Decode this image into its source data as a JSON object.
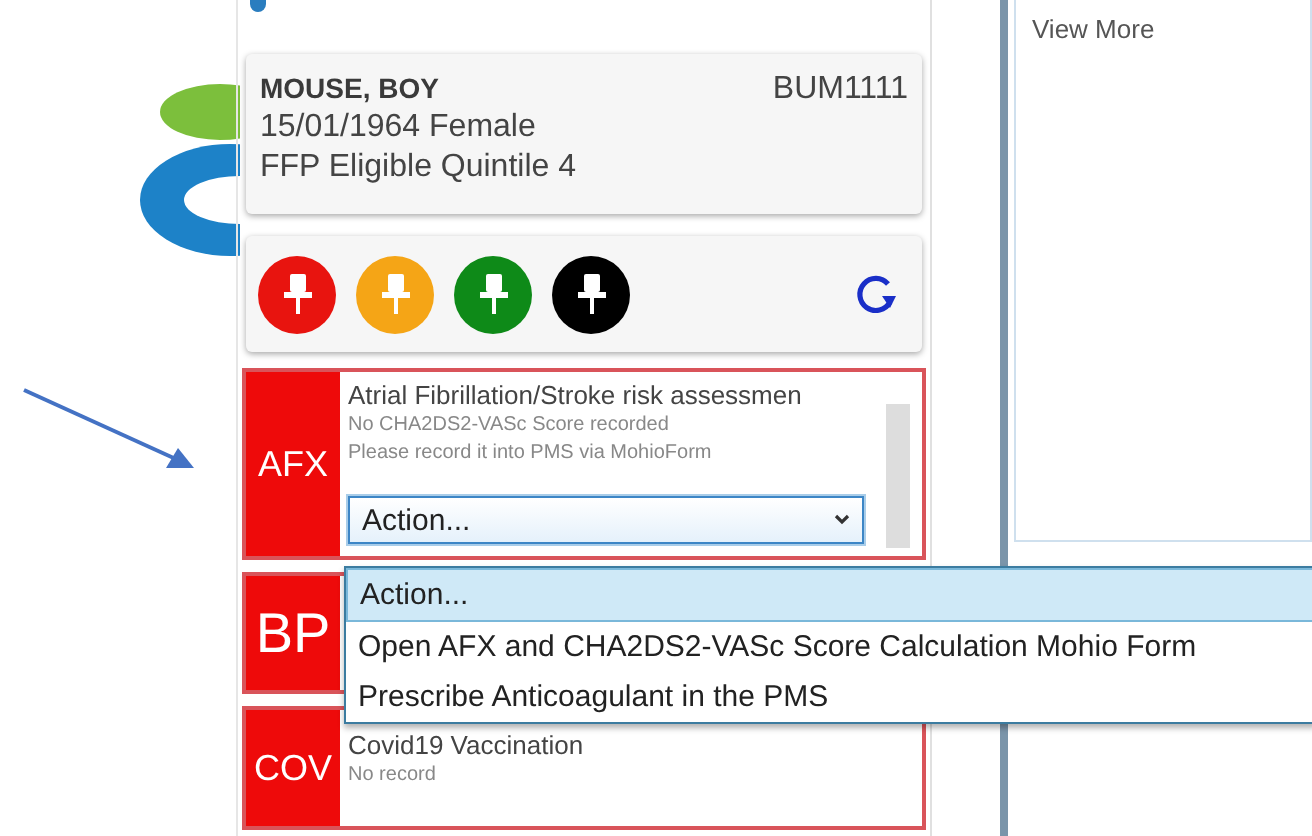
{
  "patient": {
    "name": "MOUSE, BOY",
    "id": "BUM1111",
    "details": "15/01/1964 Female",
    "eligibility": "FFP  Eligible Quintile  4"
  },
  "pins": [
    {
      "color": "#e8140f"
    },
    {
      "color": "#f5a516"
    },
    {
      "color": "#0e8a18"
    },
    {
      "color": "#000000"
    }
  ],
  "alerts": [
    {
      "code": "AFX",
      "title": "Atrial Fibrillation/Stroke risk assessmen",
      "notes": [
        "No CHA2DS2-VASc Score recorded",
        "Please record it into PMS via MohioForm"
      ],
      "action": {
        "value": "Action...",
        "expanded": true,
        "options": [
          {
            "label": "Action...",
            "selected": true
          },
          {
            "label": "Open AFX and CHA2DS2-VASc Score Calculation Mohio Form",
            "selected": false
          },
          {
            "label": "Prescribe Anticoagulant in the PMS",
            "selected": false
          }
        ]
      }
    },
    {
      "code": "BP"
    },
    {
      "code": "COV",
      "title": "Covid19 Vaccination",
      "notes": [
        "No record"
      ]
    }
  ],
  "side_panel": {
    "link": "View More"
  }
}
